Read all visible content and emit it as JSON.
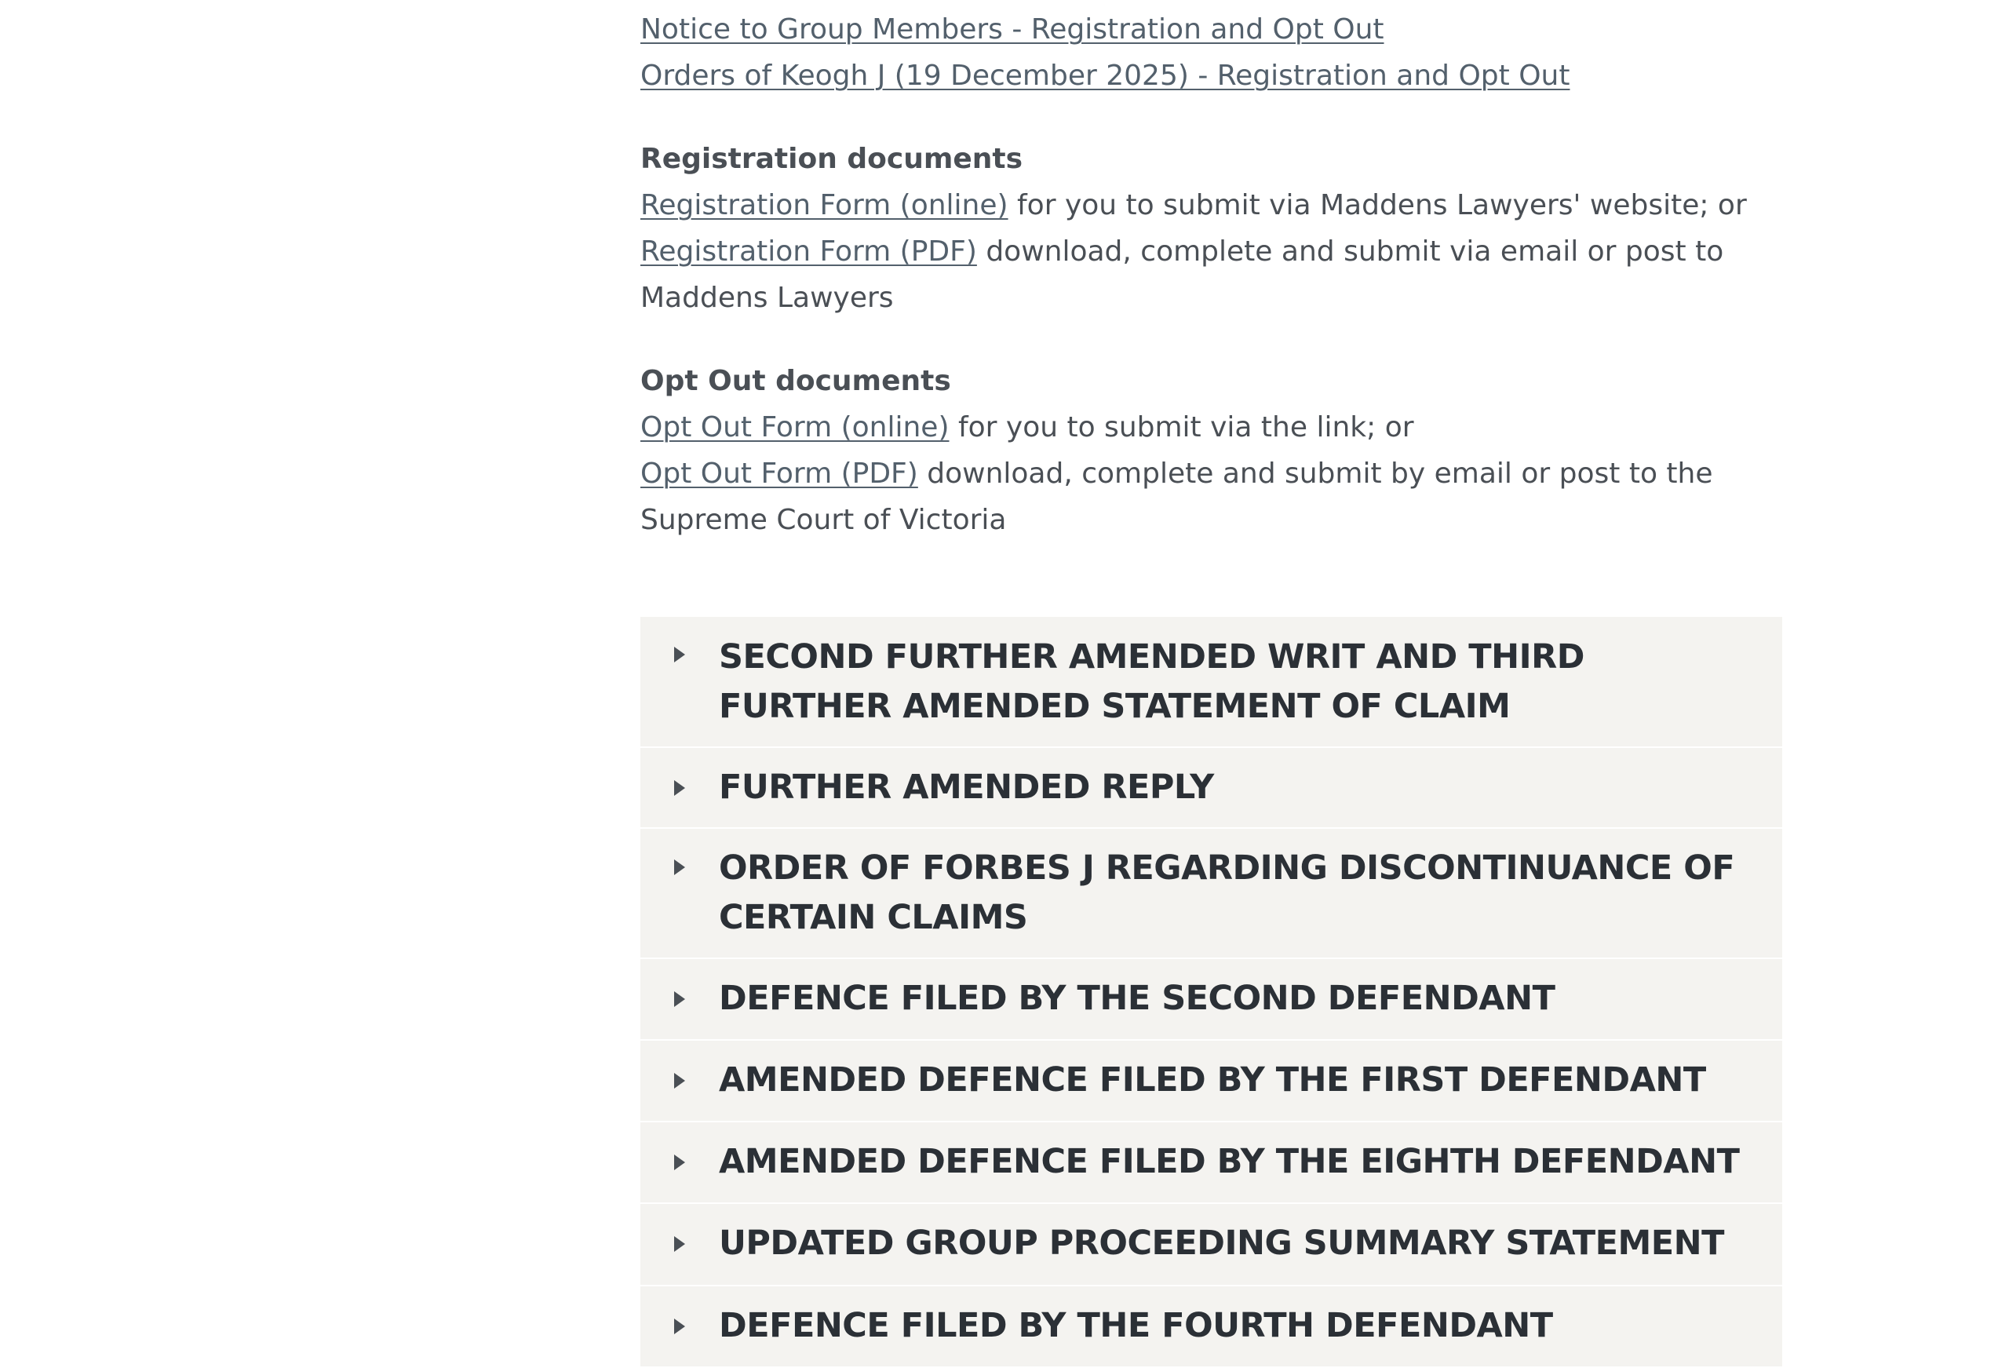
{
  "links": {
    "notice": "Notice to Group Members - Registration and Opt Out",
    "orders": "Orders of Keogh J (19 December 2025) - Registration and Opt Out"
  },
  "registration": {
    "heading": "Registration documents",
    "online_link": "Registration Form (online)",
    "online_text": " for you to submit via Maddens Lawyers' website; or",
    "pdf_link": "Registration Form (PDF)",
    "pdf_text": " download, complete and submit via email or post to Maddens Lawyers"
  },
  "opt_out": {
    "heading": "Opt Out documents",
    "online_link": "Opt Out Form (online)",
    "online_text": " for you to submit via the link; or",
    "pdf_link": "Opt Out Form (PDF)",
    "pdf_text": " download, complete and submit by email or post to the Supreme Court of Victoria"
  },
  "accordion": [
    {
      "title": "SECOND FURTHER AMENDED WRIT AND THIRD FURTHER AMENDED STATEMENT OF CLAIM",
      "expanded": false
    },
    {
      "title": "FURTHER AMENDED REPLY",
      "expanded": false
    },
    {
      "title": "ORDER OF FORBES J REGARDING DISCONTINUANCE OF CERTAIN CLAIMS",
      "expanded": false
    },
    {
      "title": "DEFENCE FILED BY THE SECOND DEFENDANT",
      "expanded": false
    },
    {
      "title": "AMENDED DEFENCE FILED BY THE FIRST DEFENDANT",
      "expanded": false
    },
    {
      "title": "AMENDED DEFENCE FILED BY THE EIGHTH DEFENDANT",
      "expanded": false
    },
    {
      "title": "UPDATED GROUP PROCEEDING SUMMARY STATEMENT",
      "expanded": false
    },
    {
      "title": "DEFENCE FILED BY THE FOURTH DEFENDANT",
      "expanded": false
    }
  ],
  "icons": {
    "accordion_toggle": "caret-right-icon"
  },
  "colors": {
    "link": "#53606c",
    "text": "#4a4f55",
    "accordion_bg": "#f4f3f0",
    "accordion_title": "#2b3036"
  }
}
